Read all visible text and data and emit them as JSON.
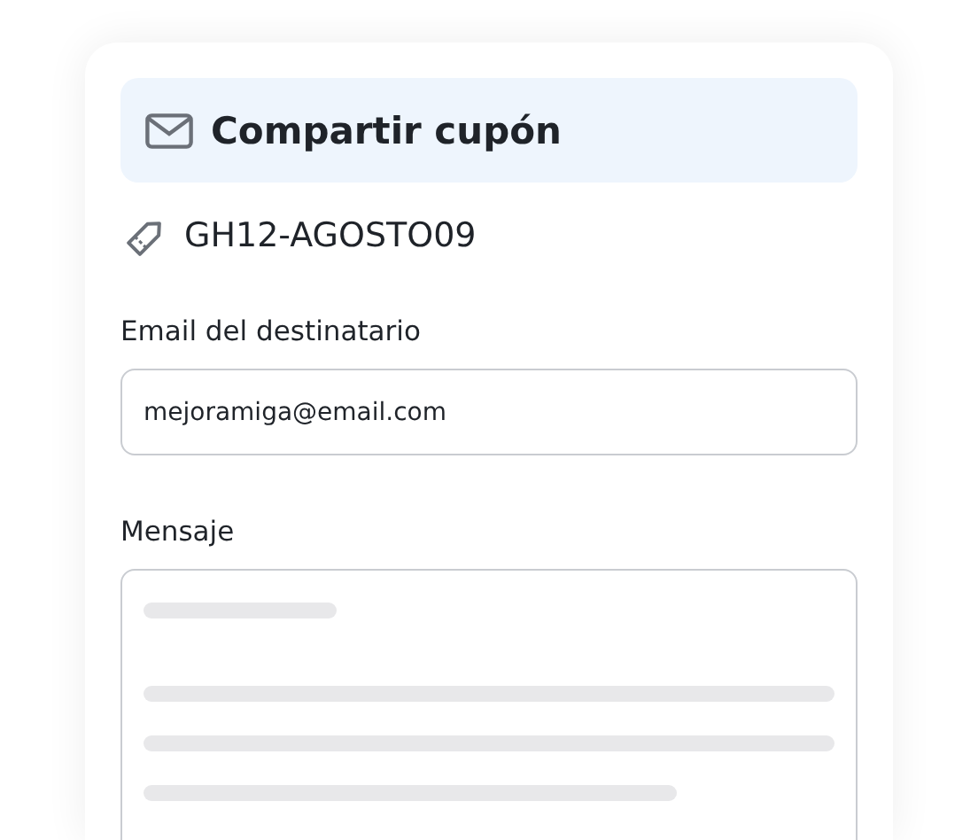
{
  "header": {
    "title": "Compartir cupón"
  },
  "coupon": {
    "code": "GH12-AGOSTO09"
  },
  "email": {
    "label": "Email del destinatario",
    "value": "mejoramiga@email.com"
  },
  "message": {
    "label": "Mensaje"
  }
}
